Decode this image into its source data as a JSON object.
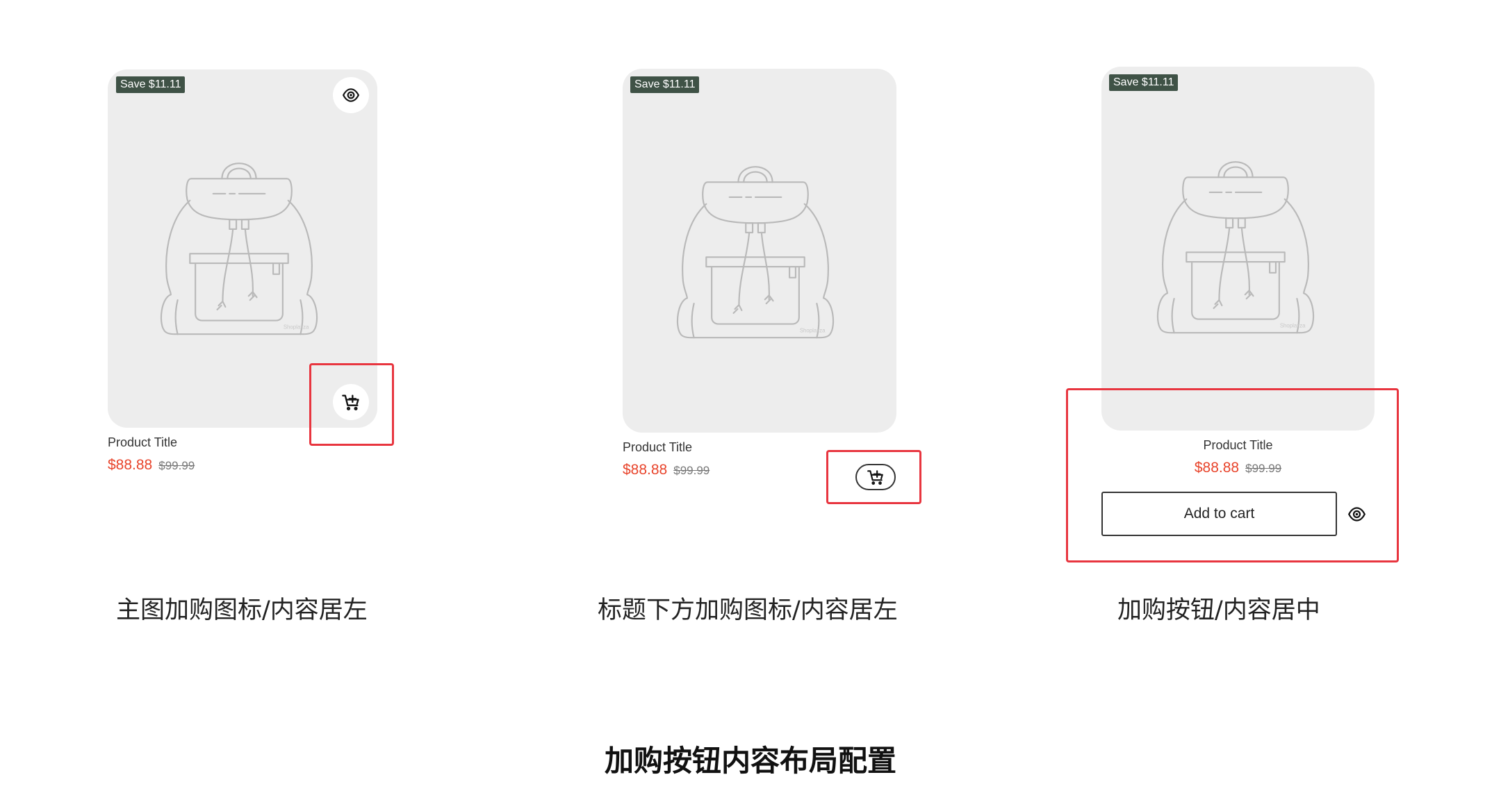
{
  "product": {
    "badge": "Save $11.11",
    "title": "Product Title",
    "price": "$88.88",
    "compare_price": "$99.99",
    "watermark": "Shoplazza",
    "add_to_cart_label": "Add to cart"
  },
  "options": [
    {
      "caption": "主图加购图标/内容居左"
    },
    {
      "caption": "标题下方加购图标/内容居左"
    },
    {
      "caption": "加购按钮/内容居中"
    }
  ],
  "page_title": "加购按钮内容布局配置",
  "colors": {
    "badge_bg": "#3f5246",
    "price": "#e8432a",
    "highlight": "#e8353f",
    "image_bg": "#ededed"
  },
  "icons": [
    "eye-icon",
    "add-to-cart-icon",
    "backpack-image"
  ]
}
